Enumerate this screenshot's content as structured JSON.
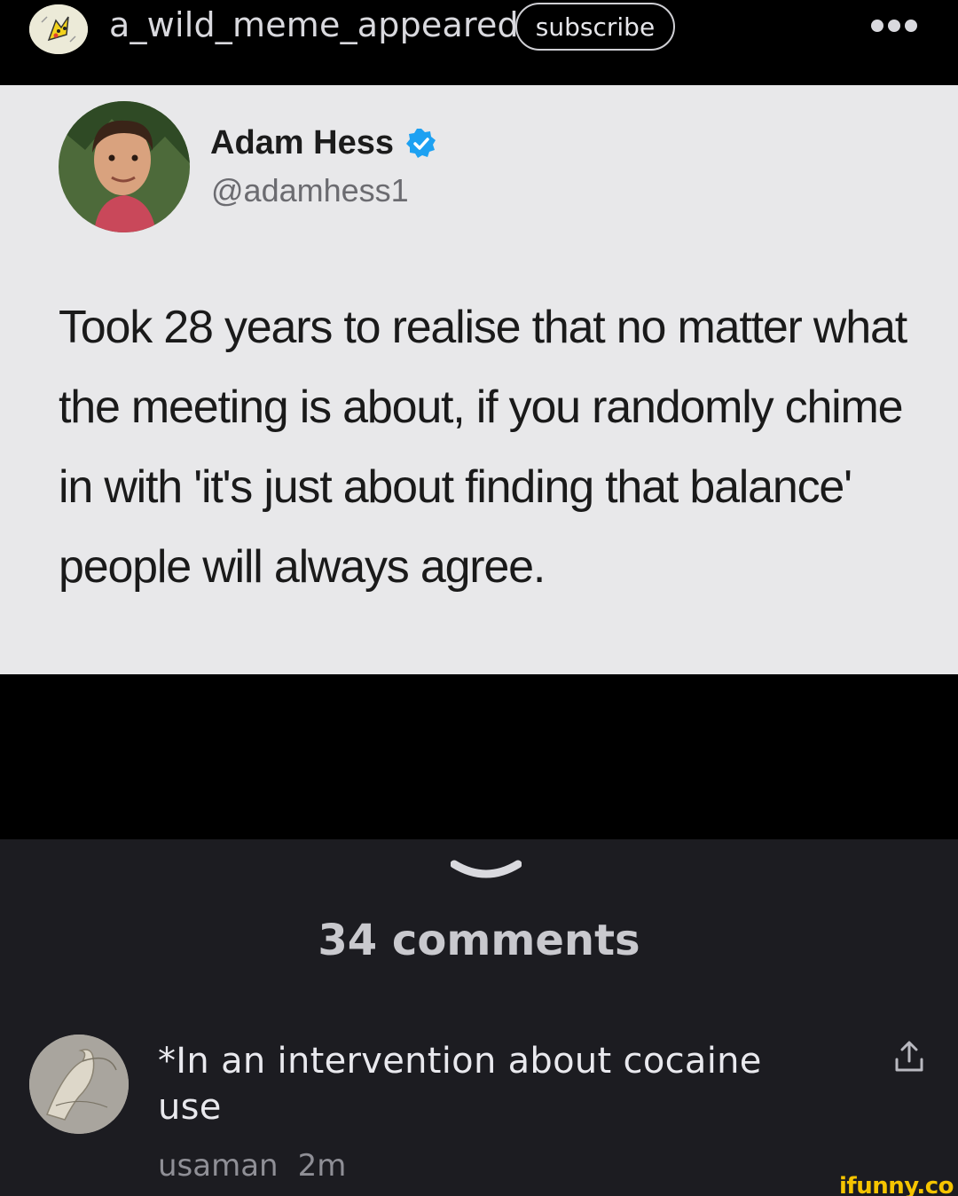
{
  "header": {
    "channel_name": "a_wild_meme_appeared",
    "subscribe_label": "subscribe",
    "avatar_icon": "pikachu-icon",
    "more_icon": "more-dots-icon"
  },
  "tweet": {
    "author_name": "Adam Hess",
    "handle": "@adamhess1",
    "verified_icon": "verified-badge-icon",
    "text": "Took 28 years to realise that no matter what the meeting is about, if you randomly chime in with 'it's just about finding that balance' people will always agree."
  },
  "comments": {
    "count_label": "34 comments",
    "collapse_icon": "chevron-down-icon",
    "items": [
      {
        "text": "*In an intervention about cocaine use",
        "username": "usaman",
        "time": "2m",
        "share_icon": "share-icon"
      }
    ]
  },
  "watermark": "ifunny.co",
  "colors": {
    "background": "#000000",
    "panel": "#1c1c21",
    "tweet_bg": "#e8e8ea",
    "verified": "#1da1f2",
    "watermark": "#f5c400"
  }
}
